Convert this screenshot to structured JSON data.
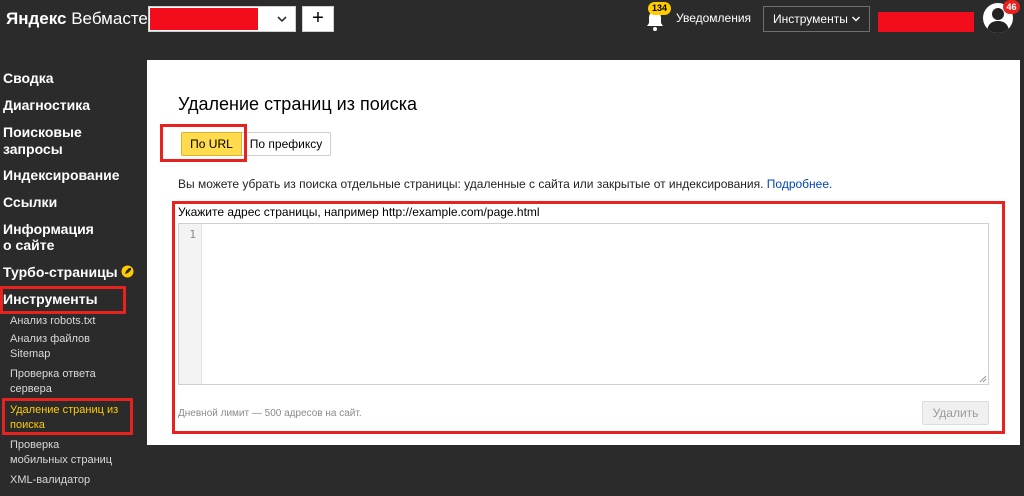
{
  "header": {
    "logo_brand": "Яндекс",
    "logo_product": "Вебмастер",
    "add_label": "+",
    "notifications_badge": "134",
    "notifications_label": "Уведомления",
    "tools_label": "Инструменты",
    "avatar_badge": "46"
  },
  "sidebar": {
    "items": [
      {
        "label": "Сводка"
      },
      {
        "label": "Диагностика"
      },
      {
        "label": "Поисковые"
      },
      {
        "label": "запросы"
      },
      {
        "label": "Индексирование"
      },
      {
        "label": "Ссылки"
      },
      {
        "label": "Информация"
      },
      {
        "label": "о сайте"
      },
      {
        "label": "Турбо-страницы"
      },
      {
        "label": "Инструменты"
      }
    ],
    "subitems": [
      {
        "label": "Анализ robots.txt"
      },
      {
        "label": "Анализ файлов"
      },
      {
        "label": "Sitemap"
      },
      {
        "label": "Проверка ответа"
      },
      {
        "label": "сервера"
      },
      {
        "label": "Удаление страниц из"
      },
      {
        "label": "поиска"
      },
      {
        "label": "Проверка"
      },
      {
        "label": "мобильных страниц"
      },
      {
        "label": "XML-валидатор"
      }
    ]
  },
  "main": {
    "title": "Удаление страниц из поиска",
    "tabs": [
      {
        "label": "По URL"
      },
      {
        "label": "По префиксу"
      }
    ],
    "description": "Вы можете убрать из поиска отдельные страницы: удаленные с сайта или закрытые от индексирования.",
    "more_link": "Подробнее.",
    "field_label": "Укажите адрес страницы, например http://example.com/page.html",
    "editor_line": "1",
    "editor_value": "",
    "limit_text": "Дневной лимит — 500 адресов на сайт.",
    "delete_label": "Удалить"
  },
  "colors": {
    "accent": "#ffdb4d",
    "highlight": "#e8231f",
    "active_nav": "#ffcc00",
    "background": "#2b2b2b"
  },
  "icons": [
    "chevron-down-icon",
    "bell-icon",
    "user-icon",
    "rocket-icon"
  ]
}
